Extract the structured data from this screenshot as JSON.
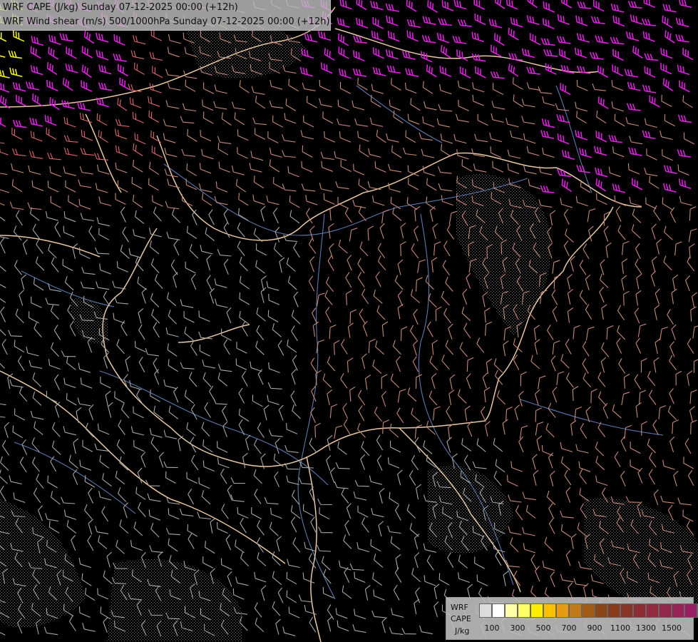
{
  "titles": {
    "line1": "WRF CAPE (J/kg) Sunday 07-12-2025 00:00 (+12h)",
    "line2": "WRF Wind shear (m/s) 500/1000hPa Sunday 07-12-2025 00:00 (+12h)"
  },
  "legend": {
    "model": "WRF",
    "field": "CAPE",
    "unit": "J/kg",
    "colors": [
      "#dcdcdc",
      "#ffffff",
      "#ffffa8",
      "#ffff66",
      "#ffee00",
      "#ffc000",
      "#e89a10",
      "#c07818",
      "#a05a14",
      "#8a4614",
      "#883c1c",
      "#8a3428",
      "#8e2c34",
      "#922a40",
      "#94264c",
      "#962258",
      "#981e64",
      "#9a1a70",
      "#9c0a80"
    ],
    "ticks": [
      "100",
      "300",
      "500",
      "700",
      "900",
      "1100",
      "1300",
      "1500"
    ]
  },
  "map": {
    "field_colors": {
      "low_shear": "#a8a8a8",
      "mid_shear": "#c88a7a",
      "high_shear": "#e0686c",
      "very_high_shear": "#e020e0",
      "extreme_shear": "#f0f020",
      "border": "#e8c8a0",
      "river": "#5a7aae",
      "stipple": "#9a9a9a"
    }
  }
}
